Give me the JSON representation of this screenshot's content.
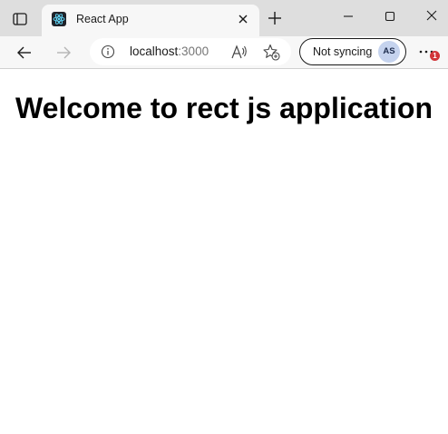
{
  "browser": {
    "tab": {
      "title": "React App",
      "favicon": "react-logo-icon"
    },
    "address_bar": {
      "host": "localhost",
      "port": ":3000"
    },
    "profile": {
      "sync_status": "Not syncing",
      "avatar_initials": "AS"
    },
    "notifications": {
      "count": "1"
    },
    "icons": {
      "tab_actions": "tab-actions-icon",
      "new_tab": "plus-icon",
      "back": "arrow-left-icon",
      "forward": "arrow-right-icon",
      "site_info": "info-icon",
      "read_aloud": "read-aloud-icon",
      "favorites": "star-add-icon",
      "more": "ellipsis-icon"
    },
    "colors": {
      "tabstrip": "#dedede",
      "toolbar": "#f7f7f7",
      "avatar_bg": "#c5d3ee",
      "badge": "#d13438",
      "react_logo": "#61dafb"
    }
  },
  "page": {
    "heading": "Welcome to rect js application"
  }
}
